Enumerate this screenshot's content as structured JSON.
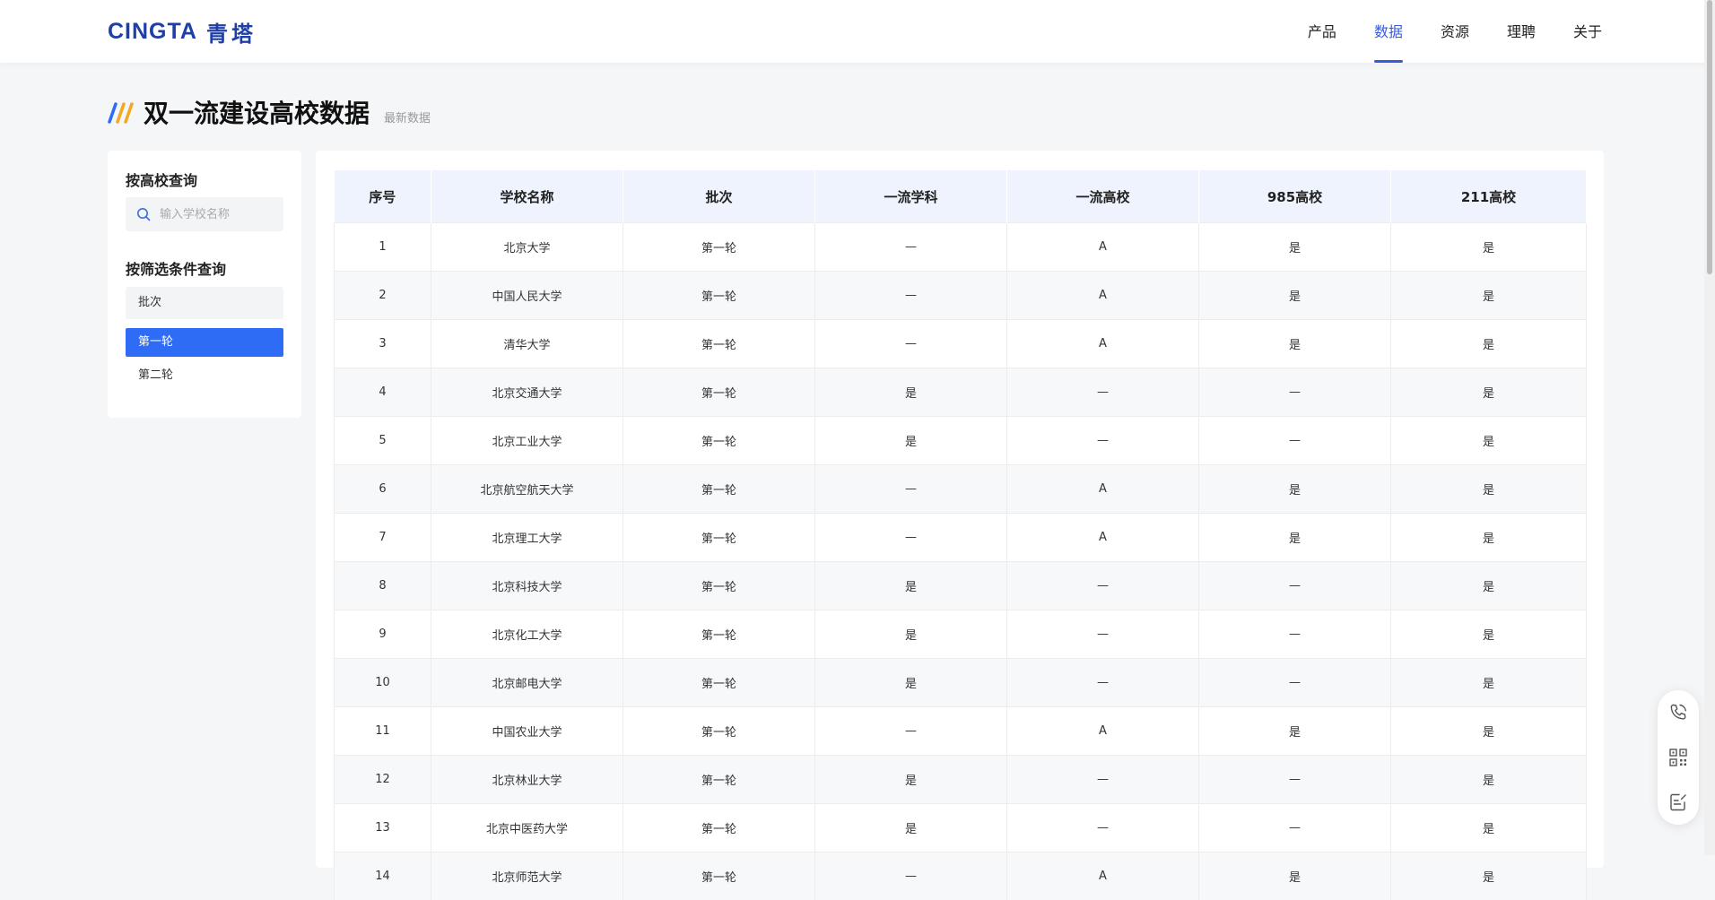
{
  "logo": {
    "en": "CINGTA",
    "cn": "青塔"
  },
  "nav": [
    {
      "label": "产品"
    },
    {
      "label": "数据"
    },
    {
      "label": "资源"
    },
    {
      "label": "理聘"
    },
    {
      "label": "关于"
    }
  ],
  "nav_active_index": 1,
  "page": {
    "title": "双一流建设高校数据",
    "subtitle": "最新数据"
  },
  "sidebar": {
    "search_heading": "按高校查询",
    "search_placeholder": "输入学校名称",
    "filter_heading": "按筛选条件查询",
    "filter_group_label": "批次",
    "filter_options": [
      {
        "label": "第一轮",
        "selected": true
      },
      {
        "label": "第二轮",
        "selected": false
      }
    ]
  },
  "table": {
    "columns": [
      "序号",
      "学校名称",
      "批次",
      "一流学科",
      "一流高校",
      "985高校",
      "211高校"
    ],
    "rows": [
      [
        "1",
        "北京大学",
        "第一轮",
        "—",
        "A",
        "是",
        "是"
      ],
      [
        "2",
        "中国人民大学",
        "第一轮",
        "—",
        "A",
        "是",
        "是"
      ],
      [
        "3",
        "清华大学",
        "第一轮",
        "—",
        "A",
        "是",
        "是"
      ],
      [
        "4",
        "北京交通大学",
        "第一轮",
        "是",
        "—",
        "—",
        "是"
      ],
      [
        "5",
        "北京工业大学",
        "第一轮",
        "是",
        "—",
        "—",
        "是"
      ],
      [
        "6",
        "北京航空航天大学",
        "第一轮",
        "—",
        "A",
        "是",
        "是"
      ],
      [
        "7",
        "北京理工大学",
        "第一轮",
        "—",
        "A",
        "是",
        "是"
      ],
      [
        "8",
        "北京科技大学",
        "第一轮",
        "是",
        "—",
        "—",
        "是"
      ],
      [
        "9",
        "北京化工大学",
        "第一轮",
        "是",
        "—",
        "—",
        "是"
      ],
      [
        "10",
        "北京邮电大学",
        "第一轮",
        "是",
        "—",
        "—",
        "是"
      ],
      [
        "11",
        "中国农业大学",
        "第一轮",
        "—",
        "A",
        "是",
        "是"
      ],
      [
        "12",
        "北京林业大学",
        "第一轮",
        "是",
        "—",
        "—",
        "是"
      ],
      [
        "13",
        "北京中医药大学",
        "第一轮",
        "是",
        "—",
        "—",
        "是"
      ],
      [
        "14",
        "北京师范大学",
        "第一轮",
        "—",
        "A",
        "是",
        "是"
      ]
    ]
  },
  "float_tools": [
    {
      "icon": "phone-icon"
    },
    {
      "icon": "qrcode-icon"
    },
    {
      "icon": "edit-note-icon"
    }
  ],
  "colors": {
    "brand": "#1e3fa8",
    "accent": "#3a5bd9",
    "selected": "#2f6cf6",
    "header_bg": "#eef3fd",
    "slash_colors": [
      "#2f6cf6",
      "#f5a623",
      "#2f6cf6"
    ]
  }
}
